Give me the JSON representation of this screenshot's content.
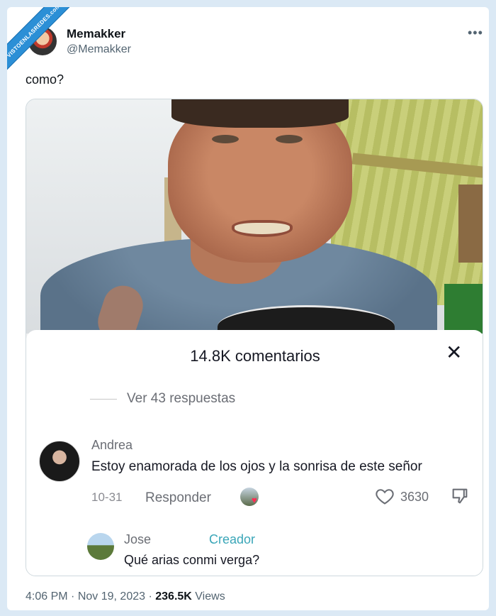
{
  "watermark": "VISTOENLASREDES.com",
  "tweet": {
    "author_name": "Memakker",
    "author_handle": "@Memakker",
    "more_icon": "more-dots-icon",
    "text": "como?",
    "time": "4:06 PM",
    "date": "Nov 19, 2023",
    "views_count": "236.5K",
    "views_label": "Views"
  },
  "comments_sheet": {
    "title": "14.8K comentarios",
    "close_icon": "close-icon",
    "view_replies": "Ver 43 respuestas",
    "comment": {
      "author": "Andrea",
      "text": "Estoy enamorada de los ojos y la sonrisa de este señor",
      "date": "10-31",
      "reply_label": "Responder",
      "likes": "3630"
    },
    "reply": {
      "author": "Jose",
      "badge": "Creador",
      "text": "Qué arias conmi verga?"
    }
  },
  "colors": {
    "background": "#dbe9f5",
    "creator_badge": "#3aa6b8",
    "like_heart": "#fe2c55"
  }
}
